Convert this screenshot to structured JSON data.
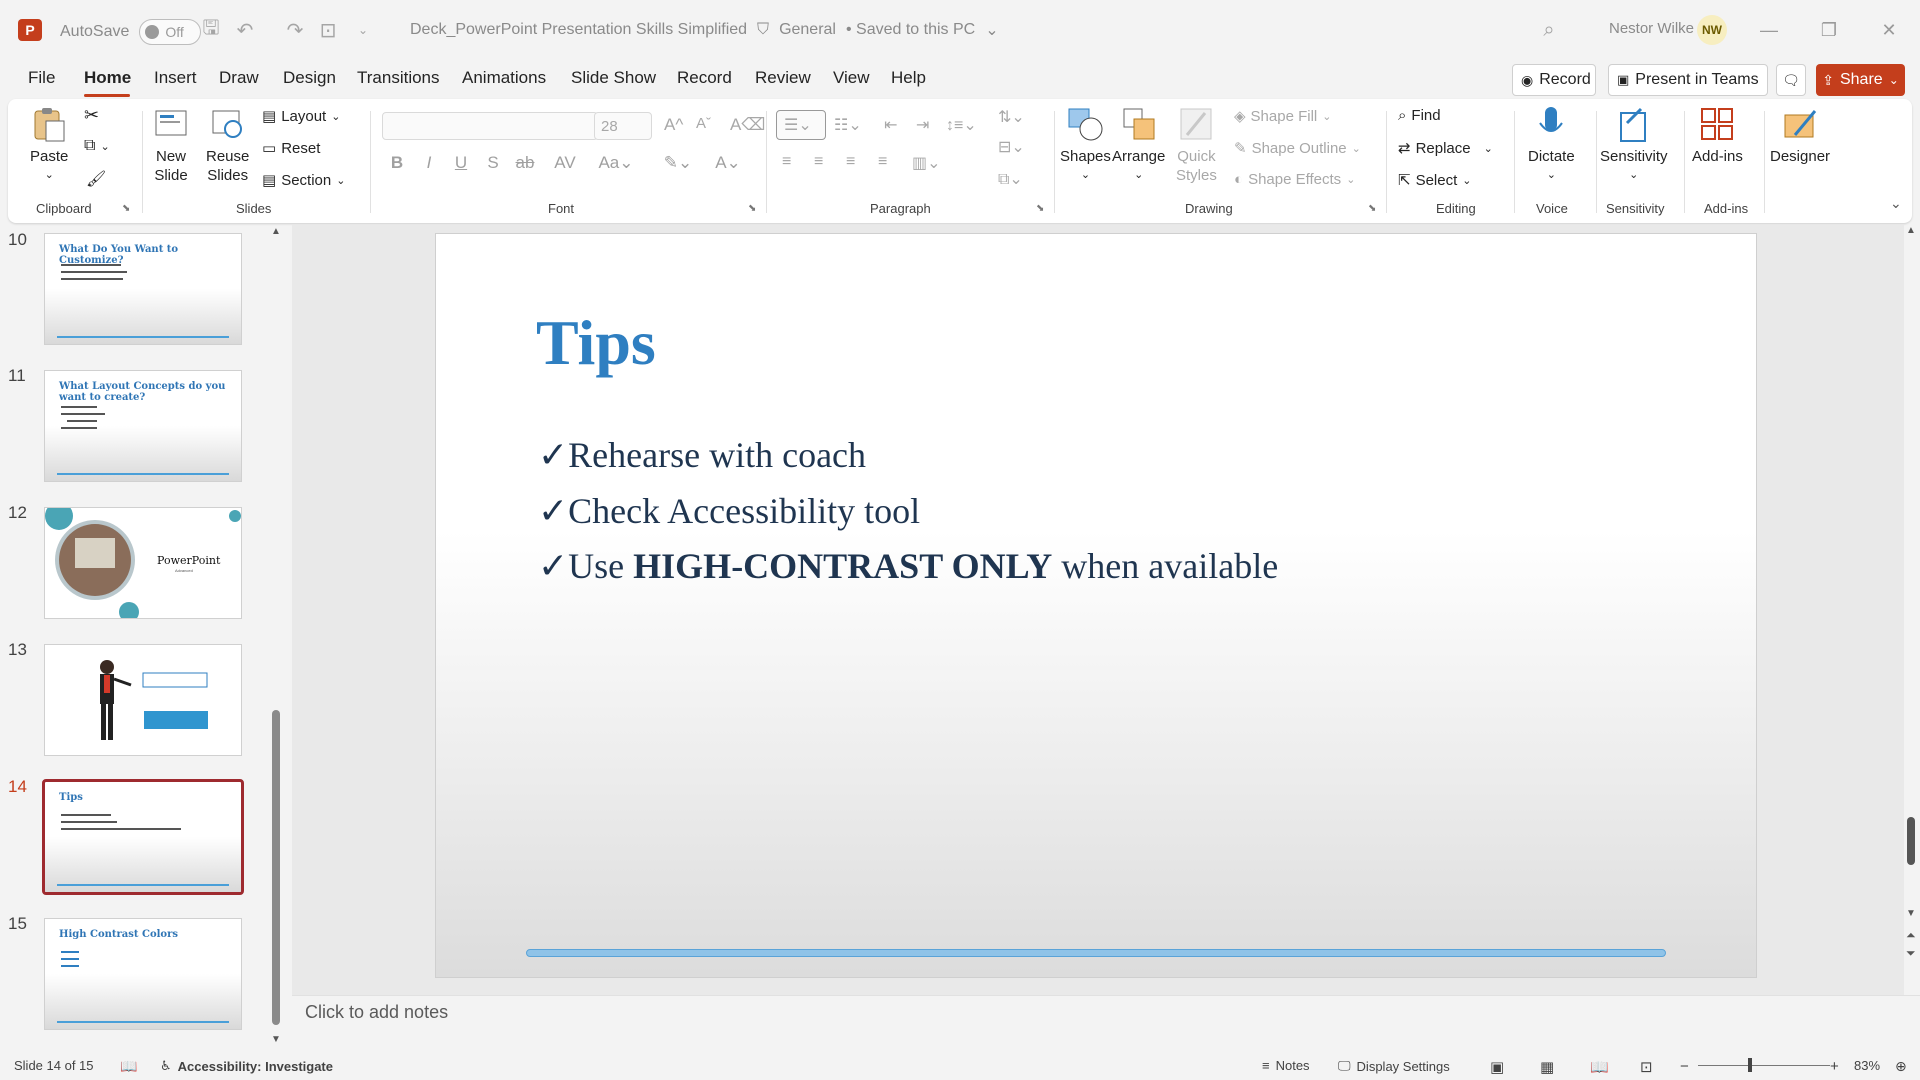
{
  "titlebar": {
    "app_icon": "powerpoint-logo",
    "autosave_label": "AutoSave",
    "autosave_state": "Off",
    "doc_title": "Deck_PowerPoint Presentation Skills Simplified",
    "sensitivity": "General",
    "save_status": "• Saved to this PC",
    "user_name": "Nestor Wilke",
    "user_initials": "NW"
  },
  "menu": {
    "tabs": [
      "File",
      "Home",
      "Insert",
      "Draw",
      "Design",
      "Transitions",
      "Animations",
      "Slide Show",
      "Record",
      "Review",
      "View",
      "Help"
    ],
    "active": "Home",
    "record_button": "Record",
    "present_button": "Present in Teams",
    "share_button": "Share"
  },
  "ribbon": {
    "clipboard": {
      "paste": "Paste",
      "label": "Clipboard"
    },
    "slides": {
      "new_slide_1": "New",
      "new_slide_2": "Slide",
      "reuse_1": "Reuse",
      "reuse_2": "Slides",
      "layout": "Layout",
      "reset": "Reset",
      "section": "Section",
      "label": "Slides"
    },
    "font": {
      "size": "28",
      "label": "Font"
    },
    "paragraph": {
      "label": "Paragraph"
    },
    "drawing": {
      "shapes": "Shapes",
      "arrange": "Arrange",
      "quick_1": "Quick",
      "quick_2": "Styles",
      "shape_fill": "Shape Fill",
      "shape_outline": "Shape Outline",
      "shape_effects": "Shape Effects",
      "label": "Drawing"
    },
    "editing": {
      "find": "Find",
      "replace": "Replace",
      "select": "Select",
      "label": "Editing"
    },
    "voice": {
      "dictate": "Dictate",
      "label": "Voice"
    },
    "sensitivity": {
      "button": "Sensitivity",
      "label": "Sensitivity"
    },
    "addins": {
      "button": "Add-ins",
      "label": "Add-ins"
    },
    "designer": {
      "button": "Designer"
    }
  },
  "thumbnails": [
    {
      "num": "10",
      "title": "What Do You Want to Customize?"
    },
    {
      "num": "11",
      "title": "What Layout Concepts do you want to create?"
    },
    {
      "num": "12",
      "title": "PowerPoint",
      "subtitle": "Advanced"
    },
    {
      "num": "13"
    },
    {
      "num": "14",
      "title": "Tips"
    },
    {
      "num": "15",
      "title": "High Contrast Colors"
    }
  ],
  "slide": {
    "title": "Tips",
    "bullets": [
      {
        "check": "✓",
        "pre": "Rehearse with coach",
        "bold": "",
        "post": ""
      },
      {
        "check": "✓",
        "pre": "Check Accessibility tool",
        "bold": "",
        "post": ""
      },
      {
        "check": "✓",
        "pre": "Use ",
        "bold": "HIGH-CONTRAST ONLY",
        "post": " when available"
      }
    ]
  },
  "notes_placeholder": "Click to add notes",
  "status": {
    "slide_counter": "Slide 14 of 15",
    "accessibility": "Accessibility: Investigate",
    "notes": "Notes",
    "display_settings": "Display Settings",
    "zoom": "83%"
  },
  "colors": {
    "accent": "#c43e1c",
    "slide_title": "#2f7fc1",
    "selected_thumb_border": "#9e2a2f"
  }
}
